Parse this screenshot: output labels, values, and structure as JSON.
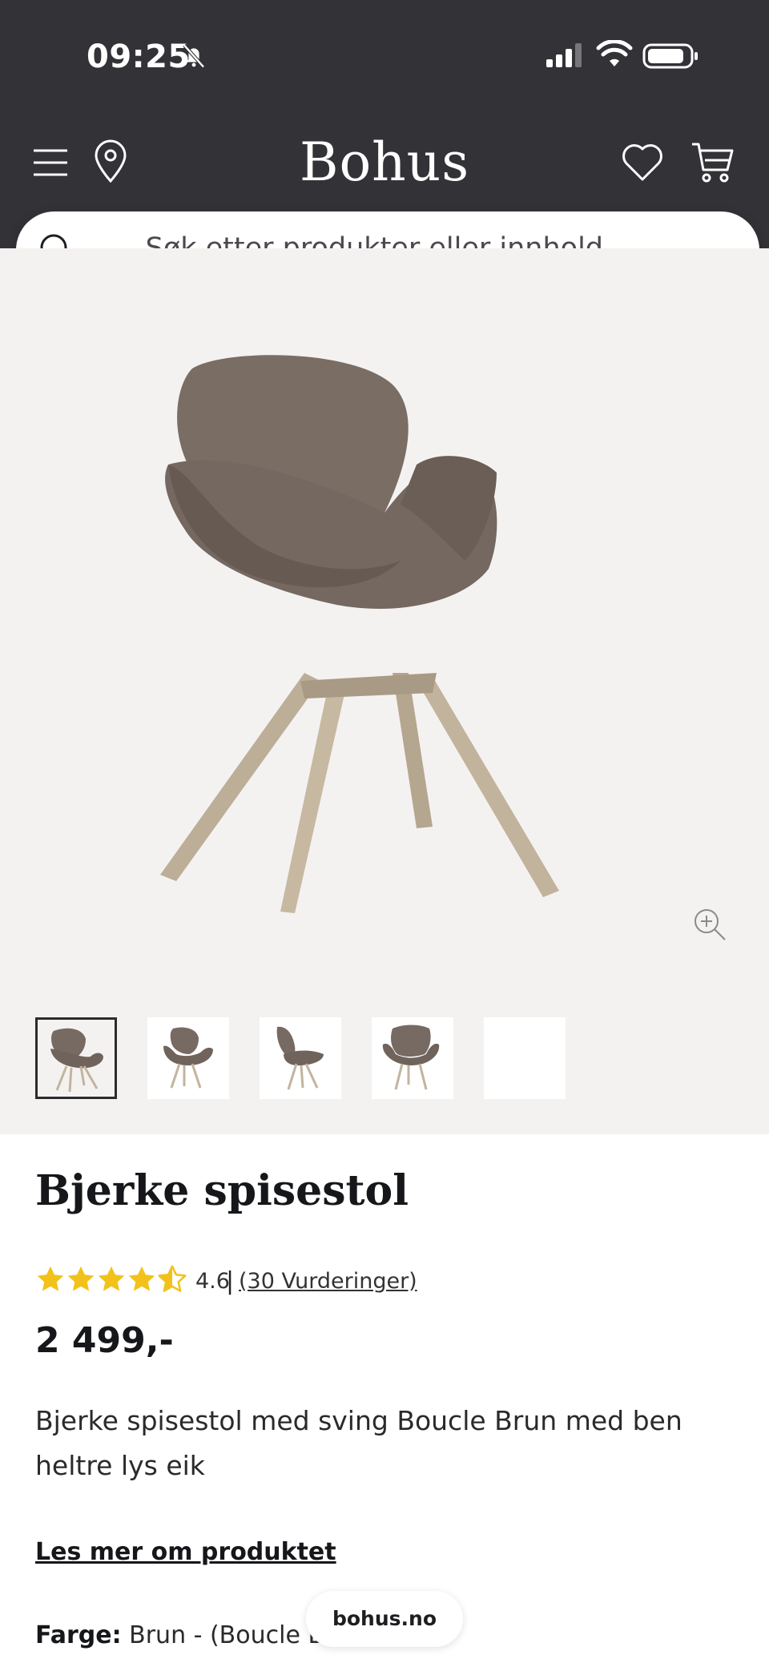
{
  "status_bar": {
    "time": "09:25"
  },
  "header": {
    "brand": "Bohus"
  },
  "search": {
    "placeholder": "Søk etter produkter eller innhold..."
  },
  "gallery": {
    "thumbnail_count": 5,
    "selected_index": 0
  },
  "product": {
    "title": "Bjerke spisestol",
    "rating_value": "4.6",
    "rating_separator": "|",
    "rating_count": "(30 Vurderinger)",
    "rating_stars": 4.5,
    "price": "2 499,-",
    "description": "Bjerke spisestol med sving Boucle Brun med ben heltre lys eik",
    "read_more": "Les mer om produktet",
    "color_label": "Farge:",
    "color_value": "Brun - (Boucle Brun)"
  },
  "browser": {
    "url": "bohus.no"
  },
  "colors": {
    "header_bg": "#333236",
    "star": "#f2c21b",
    "gallery_bg": "#f4f2f1"
  }
}
